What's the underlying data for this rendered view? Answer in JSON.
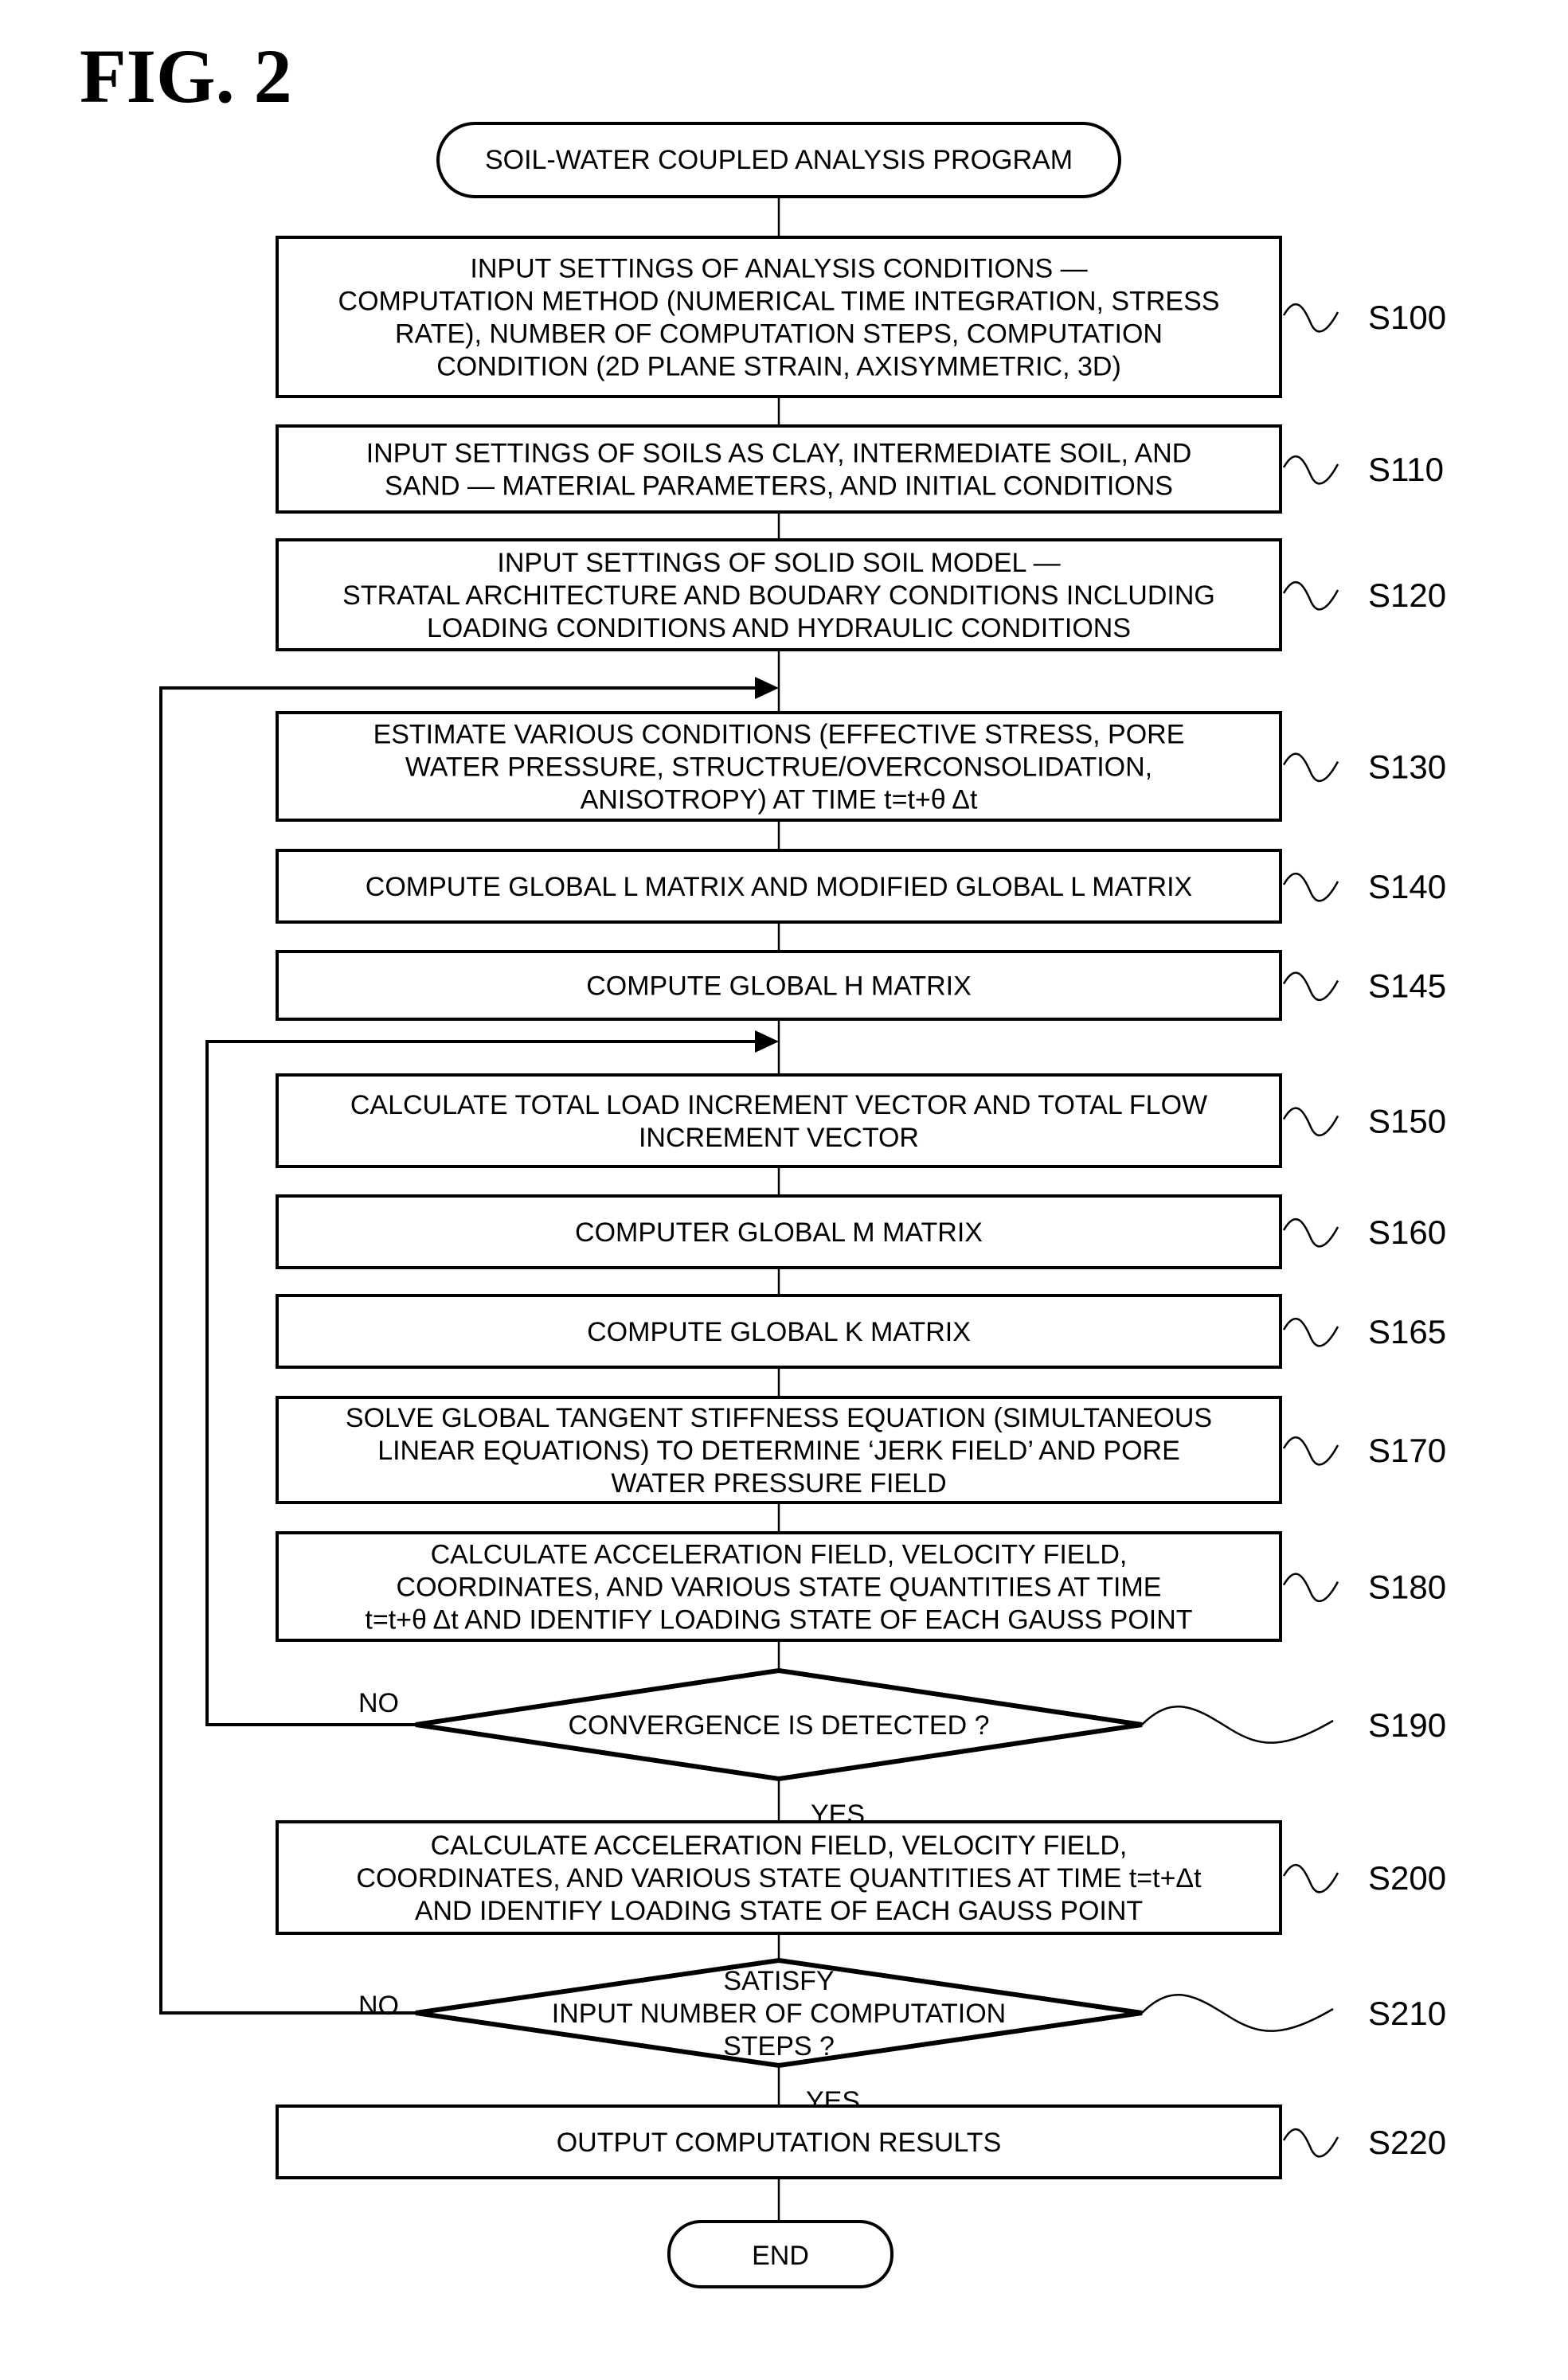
{
  "figure": {
    "title": "FIG. 2",
    "start_label": "SOIL-WATER COUPLED ANALYSIS PROGRAM",
    "end_label": "END"
  },
  "steps": [
    {
      "id": "S100",
      "type": "process",
      "lines": [
        "INPUT SETTINGS OF ANALYSIS CONDITIONS —",
        "COMPUTATION METHOD (NUMERICAL TIME INTEGRATION, STRESS",
        "RATE), NUMBER OF COMPUTATION STEPS, COMPUTATION",
        "CONDITION (2D PLANE STRAIN, AXISYMMETRIC, 3D)"
      ]
    },
    {
      "id": "S110",
      "type": "process",
      "lines": [
        "INPUT SETTINGS OF SOILS AS CLAY, INTERMEDIATE SOIL, AND",
        "SAND — MATERIAL PARAMETERS, AND INITIAL CONDITIONS"
      ]
    },
    {
      "id": "S120",
      "type": "process",
      "lines": [
        "INPUT SETTINGS OF SOLID SOIL MODEL —",
        "STRATAL ARCHITECTURE AND BOUDARY CONDITIONS INCLUDING",
        "LOADING CONDITIONS AND HYDRAULIC CONDITIONS"
      ]
    },
    {
      "id": "S130",
      "type": "process",
      "lines": [
        "ESTIMATE VARIOUS CONDITIONS (EFFECTIVE STRESS, PORE",
        "WATER PRESSURE, STRUCTRUE/OVERCONSOLIDATION,",
        "ANISOTROPY) AT TIME t=t+θ Δt"
      ]
    },
    {
      "id": "S140",
      "type": "process",
      "lines": [
        "COMPUTE GLOBAL L MATRIX AND MODIFIED GLOBAL L MATRIX"
      ]
    },
    {
      "id": "S145",
      "type": "process",
      "lines": [
        "COMPUTE GLOBAL H MATRIX"
      ]
    },
    {
      "id": "S150",
      "type": "process",
      "lines": [
        "CALCULATE TOTAL LOAD INCREMENT VECTOR AND TOTAL FLOW",
        "INCREMENT VECTOR"
      ]
    },
    {
      "id": "S160",
      "type": "process",
      "lines": [
        "COMPUTER GLOBAL M MATRIX"
      ]
    },
    {
      "id": "S165",
      "type": "process",
      "lines": [
        "COMPUTE GLOBAL K MATRIX"
      ]
    },
    {
      "id": "S170",
      "type": "process",
      "lines": [
        "SOLVE GLOBAL TANGENT STIFFNESS EQUATION (SIMULTANEOUS",
        "LINEAR EQUATIONS) TO DETERMINE ‘JERK FIELD’ AND PORE",
        "WATER PRESSURE FIELD"
      ]
    },
    {
      "id": "S180",
      "type": "process",
      "lines": [
        "CALCULATE ACCELERATION FIELD, VELOCITY FIELD,",
        "COORDINATES, AND VARIOUS STATE QUANTITIES AT TIME",
        "t=t+θ Δt AND IDENTIFY LOADING STATE OF EACH GAUSS POINT"
      ]
    },
    {
      "id": "S190",
      "type": "decision",
      "lines": [
        "CONVERGENCE IS DETECTED ?"
      ],
      "no_label": "NO",
      "yes_label": "YES"
    },
    {
      "id": "S200",
      "type": "process",
      "lines": [
        "CALCULATE ACCELERATION FIELD, VELOCITY FIELD,",
        "COORDINATES, AND VARIOUS STATE QUANTITIES AT TIME t=t+Δt",
        "AND IDENTIFY LOADING STATE OF EACH GAUSS POINT"
      ]
    },
    {
      "id": "S210",
      "type": "decision",
      "lines": [
        "SATISFY",
        "INPUT NUMBER OF COMPUTATION",
        "STEPS ?"
      ],
      "no_label": "NO",
      "yes_label": "YES"
    },
    {
      "id": "S220",
      "type": "process",
      "lines": [
        "OUTPUT COMPUTATION RESULTS"
      ]
    }
  ]
}
